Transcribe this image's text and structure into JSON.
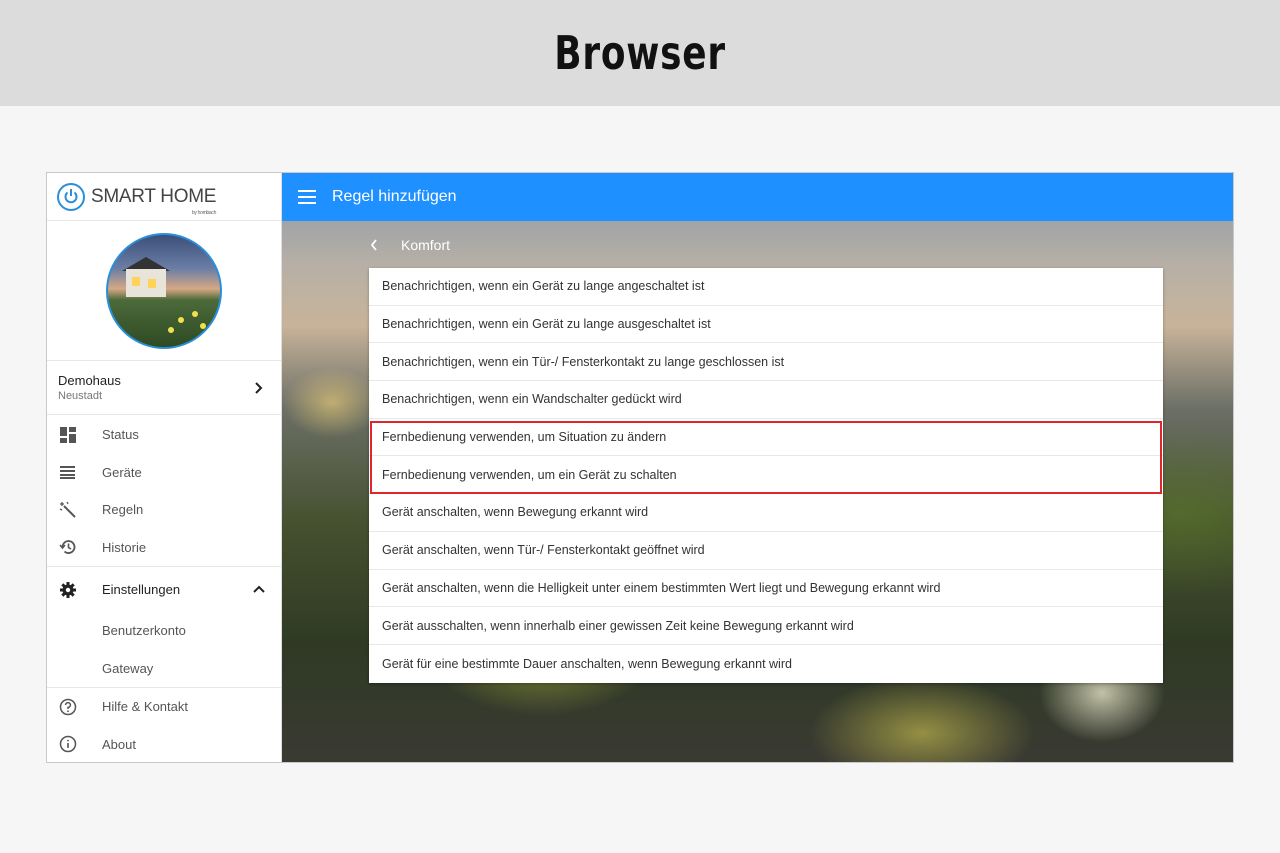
{
  "banner": {
    "title": "Browser"
  },
  "sidebar": {
    "logo_text": "SMART HOME",
    "logo_sub": "by hornbach",
    "place": {
      "name": "Demohaus",
      "location": "Neustadt"
    },
    "nav": [
      {
        "label": "Status",
        "icon": "dashboard-icon"
      },
      {
        "label": "Geräte",
        "icon": "list-icon"
      },
      {
        "label": "Regeln",
        "icon": "magic-wand-icon"
      },
      {
        "label": "Historie",
        "icon": "history-icon"
      }
    ],
    "settings": {
      "label": "Einstellungen",
      "icon": "gear-icon",
      "children": [
        "Benutzerkonto",
        "Gateway"
      ]
    },
    "footer": [
      {
        "label": "Hilfe & Kontakt",
        "icon": "help-icon"
      },
      {
        "label": "About",
        "icon": "info-icon"
      }
    ]
  },
  "topbar": {
    "title": "Regel hinzufügen"
  },
  "breadcrumb": {
    "label": "Komfort"
  },
  "rules": [
    "Benachrichtigen, wenn ein Gerät zu lange angeschaltet ist",
    "Benachrichtigen, wenn ein Gerät zu lange ausgeschaltet ist",
    "Benachrichtigen, wenn ein Tür-/ Fensterkontakt zu lange geschlossen ist",
    "Benachrichtigen, wenn ein Wandschalter gedückt wird",
    "Fernbedienung verwenden, um Situation zu ändern",
    "Fernbedienung verwenden, um ein Gerät zu schalten",
    "Gerät anschalten, wenn Bewegung erkannt wird",
    "Gerät anschalten, wenn Tür-/ Fensterkontakt geöffnet wird",
    "Gerät anschalten, wenn die Helligkeit unter einem bestimmten Wert liegt und Bewegung erkannt wird",
    "Gerät ausschalten, wenn innerhalb einer gewissen Zeit keine Bewegung erkannt wird",
    "Gerät für eine bestimmte Dauer anschalten, wenn Bewegung erkannt wird"
  ],
  "colors": {
    "accent": "#1e90ff",
    "highlight": "#e0262a"
  }
}
